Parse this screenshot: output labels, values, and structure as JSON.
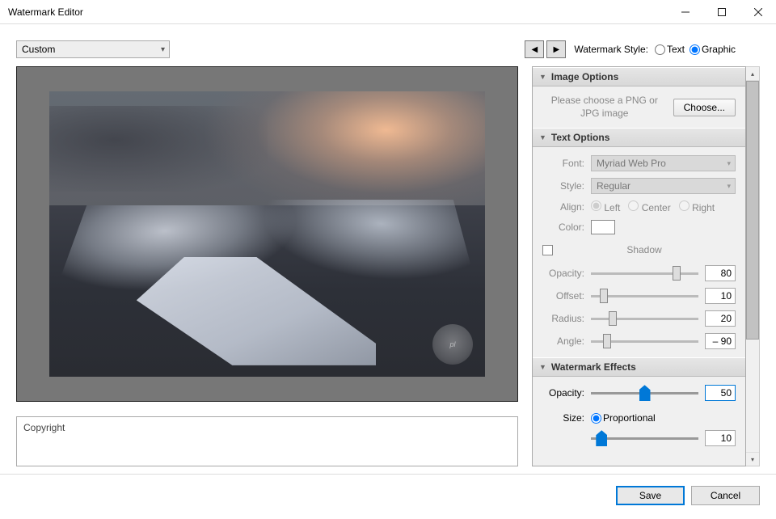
{
  "window": {
    "title": "Watermark Editor"
  },
  "preset": {
    "selected": "Custom"
  },
  "wm_style": {
    "label": "Watermark Style:",
    "text": "Text",
    "graphic": "Graphic",
    "selected": "Graphic"
  },
  "image_opts": {
    "header": "Image Options",
    "hint": "Please choose a PNG or JPG image",
    "choose": "Choose..."
  },
  "text_opts": {
    "header": "Text Options",
    "font_lbl": "Font:",
    "font_val": "Myriad Web Pro",
    "style_lbl": "Style:",
    "style_val": "Regular",
    "align_lbl": "Align:",
    "align_left": "Left",
    "align_center": "Center",
    "align_right": "Right",
    "color_lbl": "Color:"
  },
  "shadow": {
    "header": "Shadow",
    "opacity_lbl": "Opacity:",
    "opacity_val": "80",
    "opacity_pct": 80,
    "offset_lbl": "Offset:",
    "offset_val": "10",
    "offset_pct": 12,
    "radius_lbl": "Radius:",
    "radius_val": "20",
    "radius_pct": 20,
    "angle_lbl": "Angle:",
    "angle_val": "– 90",
    "angle_pct": 15
  },
  "effects": {
    "header": "Watermark Effects",
    "opacity_lbl": "Opacity:",
    "opacity_val": "50",
    "opacity_pct": 50,
    "size_lbl": "Size:",
    "size_proportional": "Proportional",
    "size_pct": 10,
    "size_val": "10"
  },
  "copyright": {
    "label": "Copyright"
  },
  "footer": {
    "save": "Save",
    "cancel": "Cancel"
  },
  "watermark_text": "pl"
}
